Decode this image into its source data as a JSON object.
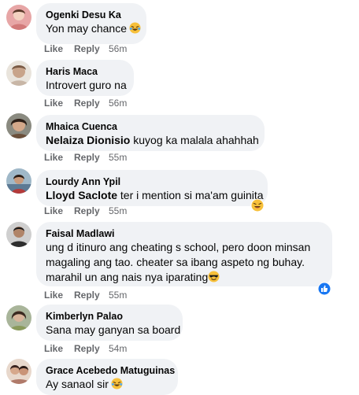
{
  "comments": [
    {
      "name": "Ogenki Desu Ka",
      "text": "Yon may chance",
      "emoji": "laughing-crying-emoji",
      "like": "Like",
      "reply": "Reply",
      "time": "56m",
      "avatar_color": "#e7a6a6"
    },
    {
      "name": "Haris Maca",
      "text": "Introvert guro na",
      "like": "Like",
      "reply": "Reply",
      "time": "56m",
      "avatar_color": "#c8b6a6"
    },
    {
      "name": "Mhaica Cuenca",
      "mention": "Nelaiza Dionisio",
      "text": " kuyog ka malala ahahhah",
      "like": "Like",
      "reply": "Reply",
      "time": "55m",
      "avatar_color": "#6b4f3a"
    },
    {
      "name": "Lourdy Ann Ypil",
      "mention": "Lloyd Saclote",
      "text": " ter i mention si ma'am guinita",
      "like": "Like",
      "reply": "Reply",
      "time": "55m",
      "reaction": "haha-reaction-icon",
      "avatar_color": "#5c7a94"
    },
    {
      "name": "Faisal Madlawi",
      "lines": [
        "ung d itinuro ang cheating s school, pero doon minsan",
        "magaling ang tao. cheater sa ibang aspeto ng buhay.",
        "marahil un ang nais nya iparating"
      ],
      "emoji": "cool-sunglasses-emoji",
      "like": "Like",
      "reply": "Reply",
      "time": "55m",
      "reaction": "like-reaction-icon",
      "avatar_color": "#3d3d3d"
    },
    {
      "name": "Kimberlyn Palao",
      "text": "Sana may ganyan sa board",
      "like": "Like",
      "reply": "Reply",
      "time": "54m",
      "avatar_color": "#8a9a5b"
    },
    {
      "name": "Grace Acebedo Matuguinas",
      "text": "Ay sanaol sir",
      "emoji": "laughing-crying-emoji",
      "avatar_color": "#b07a6a"
    }
  ],
  "colors": {
    "bubble": "#f0f2f5",
    "meta": "#65676b",
    "like_blue": "#1877f2",
    "emoji_yellow": "#f7c03a"
  }
}
